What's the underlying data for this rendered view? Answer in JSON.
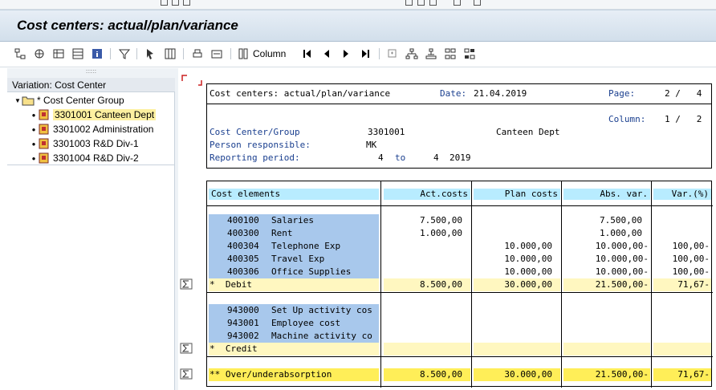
{
  "window": {
    "title": "Cost centers: actual/plan/variance"
  },
  "toolbar": {
    "column_label": "Column"
  },
  "tree": {
    "header": "Variation: Cost Center",
    "root_label": "* Cost Center Group",
    "items": [
      {
        "label": "3301001 Canteen Dept",
        "selected": true
      },
      {
        "label": "3301002 Administration",
        "selected": false
      },
      {
        "label": "3301003 R&D Div-1",
        "selected": false
      },
      {
        "label": "3301004 R&D Div-2",
        "selected": false
      }
    ]
  },
  "report": {
    "title": "Cost centers: actual/plan/variance",
    "date_label": "Date:",
    "date_value": "21.04.2019",
    "page_label": "Page:",
    "page_value": "2 /   4",
    "column_label": "Column:",
    "column_value": "1 /   2",
    "cc_group_label": "Cost Center/Group",
    "cc_group_code": "3301001",
    "cc_group_name": "Canteen Dept",
    "person_label": "Person responsible:",
    "person_value": "MK",
    "period_label": "Reporting period:",
    "period_from": "4",
    "period_to_word": "to",
    "period_to": "4",
    "period_year": "2019"
  },
  "table": {
    "headers": [
      "Cost elements",
      "Act.costs",
      "Plan costs",
      "Abs. var.",
      "Var.(%)"
    ],
    "debit_rows": [
      {
        "code": "400100",
        "name": "Salaries",
        "act": "7.500,00",
        "plan": "",
        "abs": "7.500,00",
        "pct": ""
      },
      {
        "code": "400300",
        "name": "Rent",
        "act": "1.000,00",
        "plan": "",
        "abs": "1.000,00",
        "pct": ""
      },
      {
        "code": "400304",
        "name": "Telephone Exp",
        "act": "",
        "plan": "10.000,00",
        "abs": "10.000,00-",
        "pct": "100,00-"
      },
      {
        "code": "400305",
        "name": "Travel Exp",
        "act": "",
        "plan": "10.000,00",
        "abs": "10.000,00-",
        "pct": "100,00-"
      },
      {
        "code": "400306",
        "name": "Office Supplies",
        "act": "",
        "plan": "10.000,00",
        "abs": "10.000,00-",
        "pct": "100,00-"
      }
    ],
    "debit_total": {
      "label": "*  Debit",
      "act": "8.500,00",
      "plan": "30.000,00",
      "abs": "21.500,00-",
      "pct": "71,67-"
    },
    "credit_rows": [
      {
        "code": "943000",
        "name": "Set Up activity cos"
      },
      {
        "code": "943001",
        "name": "Employee cost"
      },
      {
        "code": "943002",
        "name": "Machine activity co"
      }
    ],
    "credit_total": {
      "label": "*  Credit"
    },
    "over_total": {
      "label": "** Over/underabsorption",
      "act": "8.500,00",
      "plan": "30.000,00",
      "abs": "21.500,00-",
      "pct": "71,67-"
    }
  }
}
